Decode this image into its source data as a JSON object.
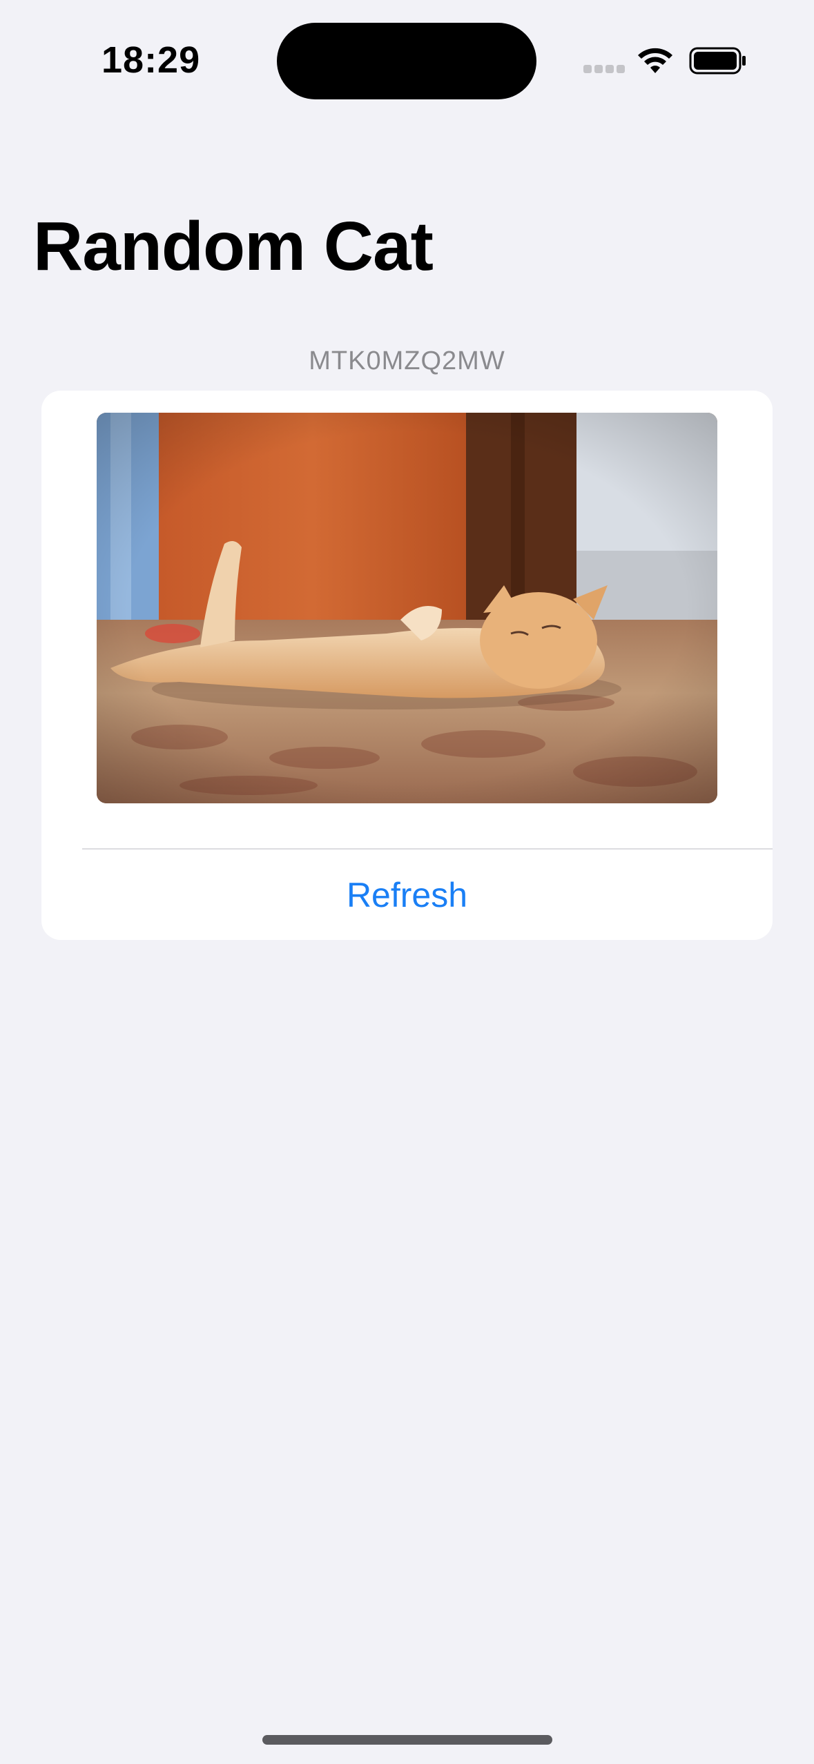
{
  "status_bar": {
    "time": "18:29"
  },
  "title": "Random Cat",
  "cat": {
    "id": "MTK0MZQ2MW"
  },
  "actions": {
    "refresh_label": "Refresh"
  },
  "colors": {
    "background": "#f2f2f7",
    "accent": "#1a7ff5",
    "card": "#ffffff"
  }
}
